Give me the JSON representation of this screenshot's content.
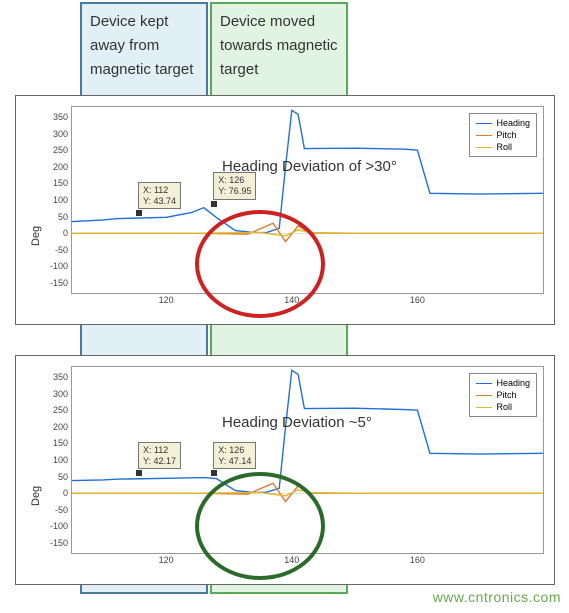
{
  "overlays": {
    "blue_label": "Device kept away from magnetic target",
    "green_label": "Device moved towards magnetic target"
  },
  "annotations": {
    "top": "Heading Deviation of >30°",
    "bottom": "Heading Deviation ~5°"
  },
  "watermark": "www.cntronics.com",
  "axis": {
    "ylabel": "Deg",
    "yticks": [
      -150,
      -100,
      -50,
      0,
      50,
      100,
      150,
      200,
      250,
      300,
      350
    ],
    "xticks": [
      120,
      140,
      160
    ],
    "ylim": [
      -180,
      380
    ],
    "xlim": [
      105,
      180
    ]
  },
  "legend": {
    "items": [
      {
        "label": "Heading",
        "color": "#1f6fd8"
      },
      {
        "label": "Pitch",
        "color": "#e07a2c"
      },
      {
        "label": "Roll",
        "color": "#e0b82c"
      }
    ]
  },
  "datatips": {
    "top_left": {
      "x": "X: 112",
      "y": "Y: 43.74"
    },
    "top_right": {
      "x": "X: 126",
      "y": "Y: 76.95"
    },
    "bot_left": {
      "x": "X: 112",
      "y": "Y: 42.17"
    },
    "bot_right": {
      "x": "X: 126",
      "y": "Y: 47.14"
    }
  },
  "chart_data": [
    {
      "type": "line",
      "title": "",
      "xlabel": "",
      "ylabel": "Deg",
      "xlim": [
        105,
        180
      ],
      "ylim": [
        -180,
        380
      ],
      "legend_position": "northeast",
      "grid": false,
      "series": [
        {
          "name": "Heading",
          "color": "#1f6fd8",
          "x": [
            105,
            110,
            112,
            120,
            124,
            126,
            128,
            131,
            134,
            136,
            138,
            139,
            140,
            141,
            142,
            150,
            158,
            160,
            162,
            170,
            180
          ],
          "values": [
            35,
            40,
            43.74,
            48,
            62,
            76.95,
            47,
            8,
            2,
            2,
            15,
            200,
            370,
            358,
            255,
            256,
            253,
            250,
            120,
            118,
            120
          ]
        },
        {
          "name": "Pitch",
          "color": "#e07a2c",
          "x": [
            105,
            125,
            133,
            137,
            139,
            141,
            143,
            150,
            180
          ],
          "values": [
            0,
            0,
            -3,
            30,
            -25,
            22,
            0,
            0,
            0
          ]
        },
        {
          "name": "Roll",
          "color": "#e0b82c",
          "x": [
            105,
            125,
            135,
            139,
            141,
            143,
            150,
            180
          ],
          "values": [
            0,
            0,
            2,
            -8,
            10,
            2,
            0,
            0
          ]
        }
      ],
      "datatips": [
        {
          "x": 112,
          "y": 43.74
        },
        {
          "x": 126,
          "y": 76.95
        }
      ]
    },
    {
      "type": "line",
      "title": "",
      "xlabel": "",
      "ylabel": "Deg",
      "xlim": [
        105,
        180
      ],
      "ylim": [
        -180,
        380
      ],
      "legend_position": "northeast",
      "grid": false,
      "series": [
        {
          "name": "Heading",
          "color": "#1f6fd8",
          "x": [
            105,
            110,
            112,
            120,
            126,
            128,
            131,
            134,
            136,
            138,
            139,
            140,
            141,
            142,
            150,
            158,
            160,
            162,
            170,
            180
          ],
          "values": [
            38,
            40,
            42.17,
            45,
            47.14,
            44,
            8,
            2,
            3,
            15,
            200,
            370,
            358,
            255,
            256,
            252,
            250,
            120,
            118,
            120
          ]
        },
        {
          "name": "Pitch",
          "color": "#e07a2c",
          "x": [
            105,
            125,
            133,
            137,
            139,
            141,
            143,
            150,
            180
          ],
          "values": [
            0,
            0,
            -3,
            30,
            -25,
            22,
            0,
            0,
            0
          ]
        },
        {
          "name": "Roll",
          "color": "#e0b82c",
          "x": [
            105,
            125,
            135,
            139,
            141,
            143,
            150,
            180
          ],
          "values": [
            0,
            0,
            2,
            -8,
            10,
            2,
            0,
            0
          ]
        }
      ],
      "datatips": [
        {
          "x": 112,
          "y": 42.17
        },
        {
          "x": 126,
          "y": 47.14
        }
      ]
    }
  ]
}
